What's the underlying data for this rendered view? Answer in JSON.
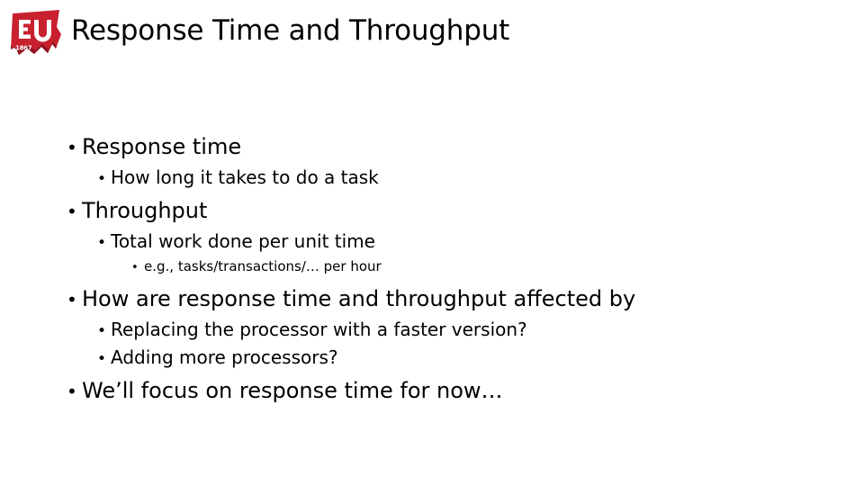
{
  "slide": {
    "background_color": "#ffffff",
    "text_color": "#000000",
    "title": "Response Time and Throughput",
    "logo": {
      "name": "eu-flag-logo",
      "initials": "EU",
      "year": "1867",
      "flag_color": "#C8202E",
      "flag_shadow_color": "#8E1520",
      "mark_color": "#ffffff"
    },
    "bullets": [
      {
        "level": 1,
        "marker": "•",
        "text": "Response time"
      },
      {
        "level": 2,
        "marker": "•",
        "text": "How long it takes to do a task"
      },
      {
        "level": 1,
        "marker": "•",
        "text": "Throughput"
      },
      {
        "level": 2,
        "marker": "•",
        "text": "Total work done per unit time"
      },
      {
        "level": 3,
        "marker": "•",
        "text": "e.g., tasks/transactions/… per hour"
      },
      {
        "level": 1,
        "marker": "•",
        "text": "How are response time and throughput affected by"
      },
      {
        "level": 2,
        "marker": "•",
        "text": "Replacing the processor with a faster version?"
      },
      {
        "level": 2,
        "marker": "•",
        "text": "Adding more processors?"
      },
      {
        "level": 1,
        "marker": "•",
        "text": "We’ll focus on response time for now…"
      }
    ]
  }
}
